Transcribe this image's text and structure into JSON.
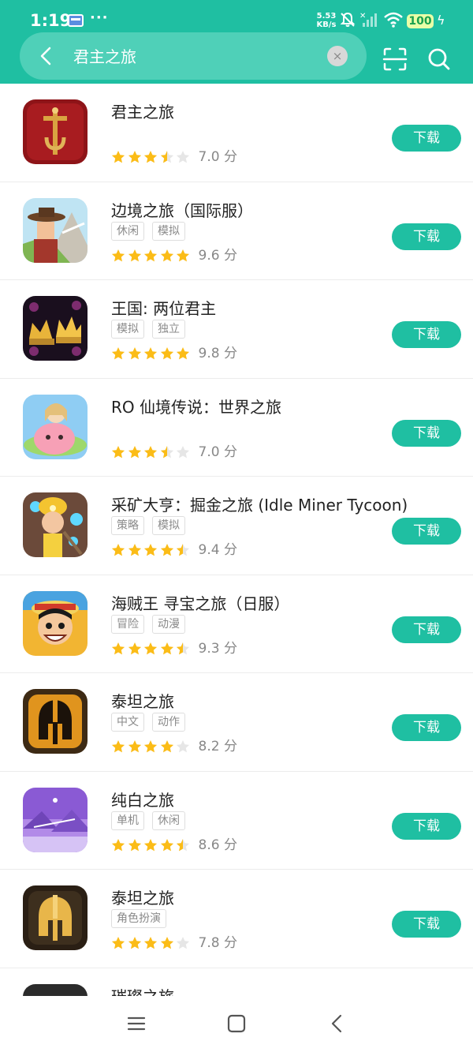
{
  "status_bar": {
    "time": "1:19",
    "dots": "···",
    "net_speed_value": "5.53",
    "net_speed_unit": "KB/s",
    "battery": "100",
    "icons": [
      "sim-card-icon",
      "mute-bell-icon",
      "cellular-signal-icon",
      "wifi-icon",
      "charging-icon"
    ]
  },
  "search": {
    "query": "君主之旅",
    "clear_label": "×"
  },
  "colors": {
    "accent": "#1fbfa2",
    "star": "#fbbc17",
    "star_empty": "#e6e6e6"
  },
  "results": [
    {
      "title": "君主之旅",
      "tags": [],
      "stars": 3.5,
      "score": "7.0 分",
      "download": "下载",
      "icon": "kings-shield-icon"
    },
    {
      "title": "边境之旅（国际服）",
      "tags": [
        "休闲",
        "模拟"
      ],
      "stars": 5,
      "score": "9.6 分",
      "download": "下载",
      "icon": "frontier-cowboy-icon"
    },
    {
      "title": "王国: 两位君主",
      "tags": [
        "模拟",
        "独立"
      ],
      "stars": 5,
      "score": "9.8 分",
      "download": "下载",
      "icon": "crowns-icon"
    },
    {
      "title": "RO 仙境传说：世界之旅",
      "tags": [],
      "stars": 3.5,
      "score": "7.0 分",
      "download": "下载",
      "icon": "ro-poring-icon"
    },
    {
      "title": "采矿大亨：掘金之旅 (Idle Miner Tycoon)",
      "tags": [
        "策略",
        "模拟"
      ],
      "stars": 4.5,
      "score": "9.4 分",
      "download": "下载",
      "icon": "miner-icon"
    },
    {
      "title": "海贼王 寻宝之旅（日服）",
      "tags": [
        "冒险",
        "动漫"
      ],
      "stars": 4.5,
      "score": "9.3 分",
      "download": "下载",
      "icon": "pirate-luffy-icon"
    },
    {
      "title": "泰坦之旅",
      "tags": [
        "中文",
        "动作"
      ],
      "stars": 4,
      "score": "8.2 分",
      "download": "下载",
      "icon": "titan-helmet-icon"
    },
    {
      "title": "纯白之旅",
      "tags": [
        "单机",
        "休闲"
      ],
      "stars": 4.5,
      "score": "8.6 分",
      "download": "下载",
      "icon": "white-journey-icon"
    },
    {
      "title": "泰坦之旅",
      "tags": [
        "角色扮演"
      ],
      "stars": 4,
      "score": "7.8 分",
      "download": "下载",
      "icon": "titan-gold-helmet-icon"
    },
    {
      "title": "璀璨之旅",
      "tags": [],
      "stars": 0,
      "score": "",
      "download": "",
      "icon": "dazzling-journey-icon"
    }
  ],
  "navbar": {
    "icons": [
      "menu-icon",
      "home-icon",
      "back-icon"
    ]
  }
}
